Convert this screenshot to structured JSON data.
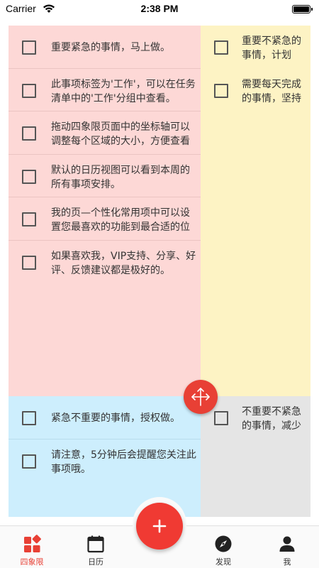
{
  "status_bar": {
    "carrier": "Carrier",
    "time": "2:38 PM"
  },
  "quadrants": {
    "urgent_important": {
      "color": "#fdd8d6",
      "tasks": [
        {
          "text": "重要紧急的事情，马上做。",
          "checked": false
        },
        {
          "text": "此事项标签为'工作'，可以在任务清单中的'工作'分组中查看。",
          "checked": false
        },
        {
          "text": "拖动四象限页面中的坐标轴可以调整每个区域的大小，方便查看",
          "checked": false
        },
        {
          "text": "默认的日历视图可以看到本周的所有事项安排。",
          "checked": false
        },
        {
          "text": "我的页—个性化常用项中可以设置您最喜欢的功能到最合适的位",
          "checked": false
        },
        {
          "text": "如果喜欢我，VIP支持、分享、好评、反馈建议都是极好的。",
          "checked": false
        }
      ]
    },
    "important_not_urgent": {
      "color": "#fdf3c4",
      "tasks": [
        {
          "line1": "重要不紧急的",
          "line2": "事情，计划",
          "checked": false
        },
        {
          "line1": "需要每天完成",
          "line2": "的事情，坚持",
          "checked": false
        }
      ]
    },
    "urgent_not_important": {
      "color": "#cdeefd",
      "tasks": [
        {
          "text": "紧急不重要的事情，授权做。",
          "checked": false
        },
        {
          "text": "请注意，5分钟后会提醒您关注此事项哦。",
          "checked": false
        }
      ]
    },
    "not_urgent_not_important": {
      "color": "#e5e5e5",
      "tasks": [
        {
          "line1": "不重要不紧急",
          "line2": "的事情，减少",
          "checked": false
        }
      ]
    }
  },
  "tab_bar": {
    "tabs": [
      {
        "label": "四象限",
        "icon": "quadrants-icon",
        "active": true
      },
      {
        "label": "日历",
        "icon": "calendar-icon",
        "active": false
      },
      {
        "label": "发现",
        "icon": "compass-icon",
        "active": false
      },
      {
        "label": "我",
        "icon": "person-icon",
        "active": false
      }
    ],
    "fab_icon": "plus-icon"
  },
  "colors": {
    "accent": "#e84035",
    "fab": "#f03a33"
  }
}
